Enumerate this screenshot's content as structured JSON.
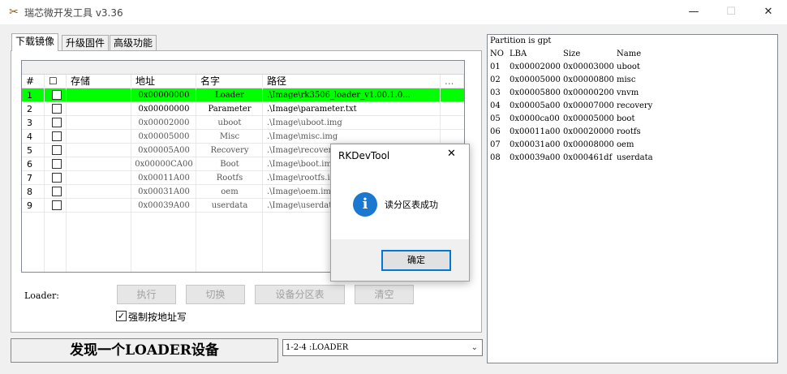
{
  "window": {
    "title": "瑞芯微开发工具 v3.36",
    "minimize": "—",
    "maximize": "☐",
    "close": "✕"
  },
  "tabs": [
    {
      "label": "下载镜像",
      "active": true
    },
    {
      "label": "升级固件",
      "active": false
    },
    {
      "label": "高级功能",
      "active": false
    }
  ],
  "table": {
    "headers": {
      "num": "#",
      "check": "☐",
      "storage": "存储",
      "address": "地址",
      "name": "名字",
      "path": "路径",
      "more": "..."
    },
    "rows": [
      {
        "num": "1",
        "address": "0x00000000",
        "name": "Loader",
        "path": ".\\Image\\rk3506_loader_v1.00.1.0...",
        "selected": true
      },
      {
        "num": "2",
        "address": "0x00000000",
        "name": "Parameter",
        "path": ".\\Image\\parameter.txt"
      },
      {
        "num": "3",
        "address": "0x00002000",
        "name": "uboot",
        "path": ".\\Image\\uboot.img"
      },
      {
        "num": "4",
        "address": "0x00005000",
        "name": "Misc",
        "path": ".\\Image\\misc.img"
      },
      {
        "num": "5",
        "address": "0x00005A00",
        "name": "Recovery",
        "path": ".\\Image\\recovery.img"
      },
      {
        "num": "6",
        "address": "0x00000CA00",
        "name": "Boot",
        "path": ".\\Image\\boot.img"
      },
      {
        "num": "7",
        "address": "0x00011A00",
        "name": "Rootfs",
        "path": ".\\Image\\rootfs.img"
      },
      {
        "num": "8",
        "address": "0x00031A00",
        "name": "oem",
        "path": ".\\Image\\oem.img"
      },
      {
        "num": "9",
        "address": "0x00039A00",
        "name": "userdata",
        "path": ".\\Image\\userdata.img"
      }
    ]
  },
  "loader_label": "Loader:",
  "buttons": {
    "execute": "执行",
    "switch": "切换",
    "device_partition": "设备分区表",
    "clear": "清空"
  },
  "force_address": {
    "label": "强制按地址写",
    "checked": true,
    "mark": "✓"
  },
  "status_text": "发现一个LOADER设备",
  "device_select": {
    "value": "1-2-4 :LOADER",
    "arrow": "⌄"
  },
  "partition": {
    "title": "Partition is gpt",
    "header": {
      "no": "NO",
      "lba": "LBA",
      "size": "Size",
      "name": "Name"
    },
    "entries": [
      {
        "no": "01",
        "lba": "0x00002000",
        "size": "0x00003000",
        "name": "uboot"
      },
      {
        "no": "02",
        "lba": "0x00005000",
        "size": "0x00000800",
        "name": "misc"
      },
      {
        "no": "03",
        "lba": "0x00005800",
        "size": "0x00000200",
        "name": "vnvm"
      },
      {
        "no": "04",
        "lba": "0x00005a00",
        "size": "0x00007000",
        "name": "recovery"
      },
      {
        "no": "05",
        "lba": "0x0000ca00",
        "size": "0x00005000",
        "name": "boot"
      },
      {
        "no": "06",
        "lba": "0x00011a00",
        "size": "0x00020000",
        "name": "rootfs"
      },
      {
        "no": "07",
        "lba": "0x00031a00",
        "size": "0x00008000",
        "name": "oem"
      },
      {
        "no": "08",
        "lba": "0x00039a00",
        "size": "0x000461df",
        "name": "userdata"
      }
    ]
  },
  "dialog": {
    "title": "RKDevTool",
    "close": "✕",
    "icon": "info-icon",
    "icon_glyph": "i",
    "message": "读分区表成功",
    "ok": "确定",
    "accent": "#0078d7"
  },
  "colors": {
    "selected_row": "#00ff00",
    "info_icon": "#1a78d1"
  }
}
